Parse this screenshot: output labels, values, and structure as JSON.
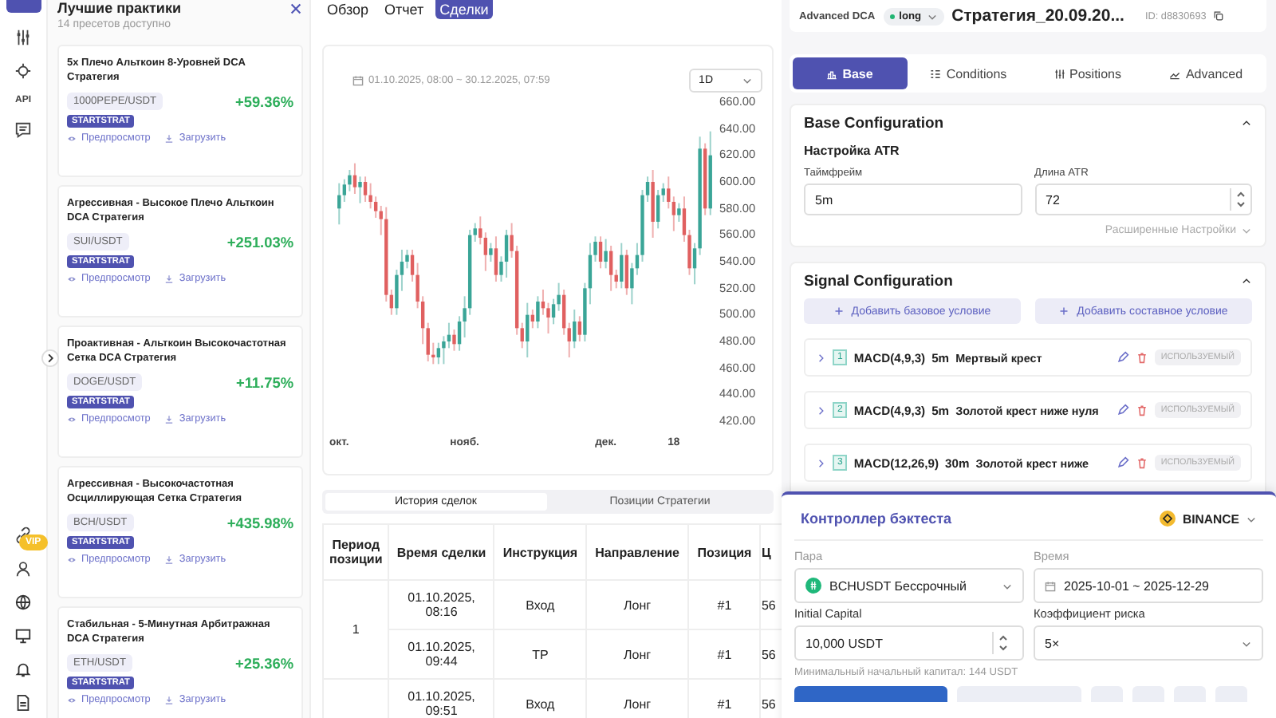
{
  "rail": {
    "api": "API",
    "vip": "VIP"
  },
  "presets": {
    "title": "Лучшие практики",
    "subtitle": "14 пресетов доступно",
    "items": [
      {
        "title": "5x Плечо Альткоин 8-Уровней DCA Стратегия",
        "pair": "1000PEPE/USDT",
        "gain": "+59.36%",
        "tag": "STARTSTRAT",
        "preview": "Предпросмотр",
        "load": "Загрузить"
      },
      {
        "title": "Агрессивная - Высокое Плечо Альткоин DCA Стратегия",
        "pair": "SUI/USDT",
        "gain": "+251.03%",
        "tag": "STARTSTRAT",
        "preview": "Предпросмотр",
        "load": "Загрузить"
      },
      {
        "title": "Проактивная - Альткоин Высокочастотная Сетка DCA Стратегия",
        "pair": "DOGE/USDT",
        "gain": "+11.75%",
        "tag": "STARTSTRAT",
        "preview": "Предпросмотр",
        "load": "Загрузить"
      },
      {
        "title": "Агрессивная - Высокочастотная Осциллирующая Сетка Стратегия",
        "pair": "BCH/USDT",
        "gain": "+435.98%",
        "tag": "STARTSTRAT",
        "preview": "Предпросмотр",
        "load": "Загрузить"
      },
      {
        "title": "Стабильная - 5-Минутная Арбитражная DCA Стратегия",
        "pair": "ETH/USDT",
        "gain": "+25.36%",
        "tag": "STARTSTRAT",
        "preview": "Предпросмотр",
        "load": "Загрузить"
      }
    ]
  },
  "view_tabs": [
    {
      "label": "Обзор",
      "selected": false
    },
    {
      "label": "Отчет",
      "selected": false
    },
    {
      "label": "Сделки",
      "selected": true
    }
  ],
  "chart": {
    "date_range": "01.10.2025, 08:00 ~ 30.12.2025, 07:59",
    "interval": "1D",
    "chart_data": {
      "type": "candlestick",
      "categories": [
        "окт.",
        null,
        null,
        null,
        null,
        null,
        null,
        null,
        null,
        null,
        null,
        null,
        null,
        null,
        null,
        null,
        null,
        null,
        null,
        null,
        null,
        null,
        null,
        null,
        "нояб.",
        null,
        null,
        null,
        null,
        null,
        null,
        null,
        null,
        null,
        null,
        null,
        null,
        null,
        null,
        null,
        null,
        null,
        null,
        null,
        null,
        null,
        null,
        null,
        null,
        null,
        null,
        "дек.",
        null,
        null,
        null,
        null,
        null,
        null,
        null,
        null,
        null,
        null,
        null,
        null,
        "18",
        null,
        null,
        null,
        null,
        null,
        null,
        null
      ],
      "ohlc": [
        [
          580,
          599,
          568,
          590
        ],
        [
          590,
          602,
          585,
          598
        ],
        [
          598,
          609,
          593,
          605
        ],
        [
          605,
          614,
          591,
          596
        ],
        [
          596,
          604,
          584,
          600
        ],
        [
          600,
          604,
          585,
          590
        ],
        [
          590,
          599,
          580,
          585
        ],
        [
          585,
          589,
          573,
          578
        ],
        [
          578,
          582,
          560,
          572
        ],
        [
          572,
          581,
          510,
          515
        ],
        [
          515,
          519,
          500,
          505
        ],
        [
          505,
          534,
          500,
          530
        ],
        [
          530,
          549,
          518,
          540
        ],
        [
          540,
          549,
          535,
          545
        ],
        [
          545,
          549,
          525,
          530
        ],
        [
          530,
          539,
          505,
          510
        ],
        [
          510,
          514,
          478,
          490
        ],
        [
          490,
          494,
          465,
          470
        ],
        [
          470,
          479,
          463,
          468
        ],
        [
          468,
          479,
          463,
          475
        ],
        [
          475,
          484,
          463,
          480
        ],
        [
          480,
          494,
          475,
          485
        ],
        [
          485,
          489,
          473,
          478
        ],
        [
          478,
          499,
          473,
          495
        ],
        [
          495,
          514,
          483,
          505
        ],
        [
          505,
          564,
          500,
          560
        ],
        [
          560,
          569,
          555,
          565
        ],
        [
          565,
          574,
          553,
          558
        ],
        [
          558,
          562,
          533,
          545
        ],
        [
          545,
          554,
          540,
          550
        ],
        [
          550,
          559,
          525,
          530
        ],
        [
          530,
          544,
          525,
          540
        ],
        [
          540,
          564,
          528,
          560
        ],
        [
          560,
          569,
          543,
          548
        ],
        [
          548,
          552,
          485,
          490
        ],
        [
          490,
          494,
          475,
          480
        ],
        [
          480,
          509,
          468,
          500
        ],
        [
          500,
          504,
          490,
          495
        ],
        [
          495,
          514,
          490,
          510
        ],
        [
          510,
          519,
          500,
          505
        ],
        [
          505,
          509,
          486,
          498
        ],
        [
          498,
          512,
          493,
          508
        ],
        [
          508,
          524,
          503,
          515
        ],
        [
          515,
          519,
          485,
          490
        ],
        [
          490,
          494,
          468,
          480
        ],
        [
          480,
          504,
          475,
          495
        ],
        [
          495,
          499,
          480,
          485
        ],
        [
          485,
          524,
          480,
          520
        ],
        [
          520,
          554,
          508,
          545
        ],
        [
          545,
          559,
          540,
          555
        ],
        [
          555,
          559,
          535,
          540
        ],
        [
          540,
          557,
          535,
          548
        ],
        [
          548,
          552,
          518,
          530
        ],
        [
          530,
          534,
          520,
          525
        ],
        [
          525,
          554,
          520,
          545
        ],
        [
          545,
          549,
          515,
          520
        ],
        [
          520,
          539,
          508,
          535
        ],
        [
          535,
          554,
          530,
          545
        ],
        [
          545,
          594,
          540,
          590
        ],
        [
          590,
          604,
          585,
          600
        ],
        [
          600,
          609,
          558,
          570
        ],
        [
          570,
          594,
          565,
          590
        ],
        [
          590,
          599,
          585,
          595
        ],
        [
          595,
          604,
          580,
          585
        ],
        [
          585,
          589,
          563,
          575
        ],
        [
          575,
          584,
          570,
          580
        ],
        [
          580,
          589,
          555,
          560
        ],
        [
          560,
          564,
          530,
          535
        ],
        [
          535,
          554,
          523,
          550
        ],
        [
          550,
          634,
          545,
          625
        ],
        [
          625,
          629,
          575,
          580
        ],
        [
          580,
          638,
          575,
          620
        ]
      ],
      "ylim": [
        420,
        660
      ],
      "yticks": [
        {
          "value": 660,
          "label": "660.00"
        },
        {
          "value": 640,
          "label": "640.00"
        },
        {
          "value": 620,
          "label": "620.00"
        },
        {
          "value": 600,
          "label": "600.00"
        },
        {
          "value": 580,
          "label": "580.00"
        },
        {
          "value": 560,
          "label": "560.00"
        },
        {
          "value": 540,
          "label": "540.00"
        },
        {
          "value": 520,
          "label": "520.00"
        },
        {
          "value": 500,
          "label": "500.00"
        },
        {
          "value": 480,
          "label": "480.00"
        },
        {
          "value": 460,
          "label": "460.00"
        },
        {
          "value": 440,
          "label": "440.00"
        },
        {
          "value": 420,
          "label": "420.00"
        }
      ]
    }
  },
  "table_tabs": [
    {
      "label": "История сделок",
      "selected": true
    },
    {
      "label": "Позиции Стратегии",
      "selected": false
    }
  ],
  "table": {
    "columns": [
      "Период позиции",
      "Время сделки",
      "Инструкция",
      "Направление",
      "Позиция",
      "Ц"
    ],
    "groups": [
      {
        "period": "1",
        "trades": [
          [
            "01.10.2025, 08:16",
            "Вход",
            "Лонг",
            "#1",
            "56"
          ],
          [
            "01.10.2025, 09:44",
            "TP",
            "Лонг",
            "#1",
            "56"
          ]
        ]
      },
      {
        "trades": [
          [
            "01.10.2025, 09:51",
            "Вход",
            "Лонг",
            "#1",
            "56"
          ]
        ]
      }
    ]
  },
  "strategy": {
    "type": "Advanced DCA",
    "direction": "long",
    "name": "Стратегия_20.09.20...",
    "id": "ID: d8830693"
  },
  "config_tabs": [
    {
      "label": "Base",
      "selected": true
    },
    {
      "label": "Conditions",
      "selected": false
    },
    {
      "label": "Positions",
      "selected": false
    },
    {
      "label": "Advanced",
      "selected": false
    }
  ],
  "base_config": {
    "title": "Base Configuration",
    "section": "Настройка ATR",
    "fields": [
      {
        "label": "Таймфрейм",
        "value": "5m",
        "kind": "text"
      },
      {
        "label": "Длина ATR",
        "value": "72",
        "kind": "number"
      }
    ],
    "advanced": "Расширенные Настройки"
  },
  "signal_config": {
    "title": "Signal Configuration",
    "buttons": [
      "Добавить базовое условие",
      "Добавить составное условие"
    ],
    "conditions": [
      {
        "index": "1",
        "indicator": "MACD(4,9,3)",
        "timeframe": "5m",
        "signal": "Мертвый крест",
        "status": "ИСПОЛЬЗУЕМЫЙ"
      },
      {
        "index": "2",
        "indicator": "MACD(4,9,3)",
        "timeframe": "5m",
        "signal": "Золотой крест ниже нуля",
        "status": "ИСПОЛЬЗУЕМЫЙ"
      },
      {
        "index": "3",
        "indicator": "MACD(12,26,9)",
        "timeframe": "30m",
        "signal": "Золотой крест ниже",
        "status": "ИСПОЛЬЗУЕМЫЙ"
      }
    ]
  },
  "backtest": {
    "title": "Контроллер бэктеста",
    "exchange": "BINANCE",
    "pair_label": "Пара",
    "pair": "BCHUSDT Бессрочный",
    "time_label": "Время",
    "time": "2025-10-01 ~ 2025-12-29",
    "capital_label": "Initial Capital",
    "capital": "10,000 USDT",
    "risk_label": "Коэффициент риска",
    "risk": "5×",
    "hint": "Минимальный начальный капитал: 144 USDT"
  }
}
